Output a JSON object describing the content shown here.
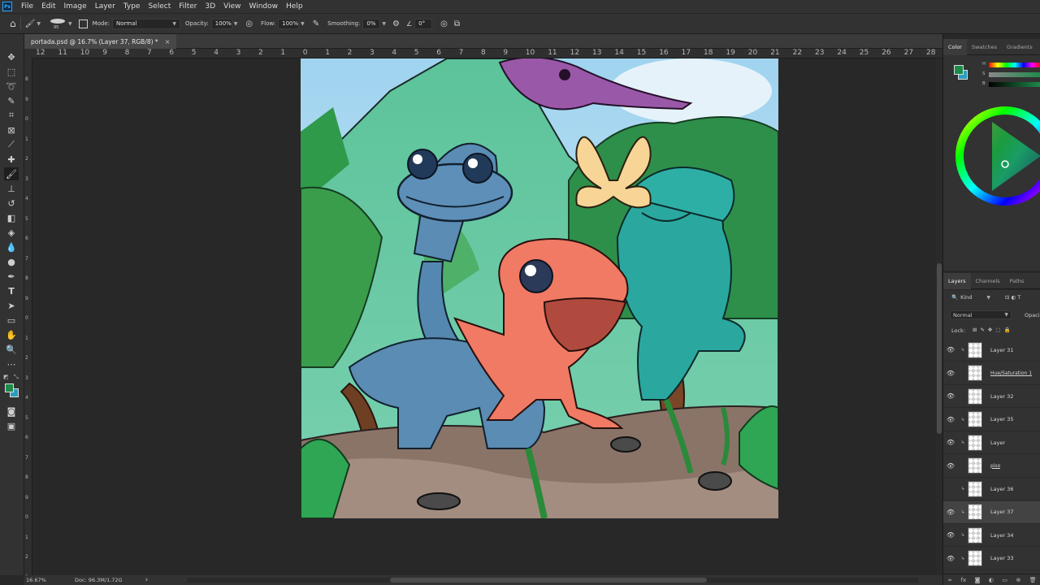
{
  "menu": {
    "logo": "Ps",
    "items": [
      "File",
      "Edit",
      "Image",
      "Layer",
      "Type",
      "Select",
      "Filter",
      "3D",
      "View",
      "Window",
      "Help"
    ]
  },
  "options": {
    "brush_size": "95",
    "mode_label": "Mode:",
    "mode_value": "Normal",
    "opacity_label": "Opacity:",
    "opacity_value": "100%",
    "flow_label": "Flow:",
    "flow_value": "100%",
    "smoothing_label": "Smoothing:",
    "smoothing_value": "0%",
    "angle_value": "0°"
  },
  "document": {
    "tab_title": "portada.psd @ 16.7% (Layer 37, RGB/8) *",
    "close": "×"
  },
  "ruler_top_labels": [
    "12",
    "11",
    "10",
    "9",
    "8",
    "7",
    "6",
    "5",
    "4",
    "3",
    "2",
    "1",
    "0",
    "1",
    "2",
    "3",
    "4",
    "5",
    "6",
    "7",
    "8",
    "9",
    "10",
    "11",
    "12",
    "13",
    "14",
    "15",
    "16",
    "17",
    "18",
    "19",
    "20",
    "21",
    "22",
    "23",
    "24",
    "25",
    "26",
    "27",
    "28"
  ],
  "ruler_left_labels": [
    "8",
    "9",
    "0",
    "1",
    "2",
    "3",
    "4",
    "5",
    "6",
    "7",
    "8",
    "9",
    "0",
    "1",
    "2",
    "3",
    "4",
    "5",
    "6",
    "7",
    "8",
    "9",
    "0",
    "1",
    "2",
    "3"
  ],
  "status": {
    "zoom": "16.67%",
    "doc": "Doc: 96.3M/1.72G",
    "arrow": "›"
  },
  "color_panel": {
    "tabs": [
      "Color",
      "Swatches",
      "Gradients",
      "P"
    ],
    "slider_labels": [
      "H",
      "S",
      "B"
    ],
    "foreground": "#1e8a4a",
    "background": "#2a9dc0"
  },
  "layers_panel": {
    "tabs": [
      "Layers",
      "Channels",
      "Paths"
    ],
    "filter_kind": "Kind",
    "blend_mode": "Normal",
    "opacity_label": "Opaci",
    "lock_label": "Lock:",
    "layers": [
      {
        "name": "Layer 31",
        "visible": true,
        "clipped": true,
        "selected": false
      },
      {
        "name": "Hue/Saturation 1",
        "visible": true,
        "clipped": false,
        "selected": false
      },
      {
        "name": "Layer 32",
        "visible": true,
        "clipped": false,
        "selected": false
      },
      {
        "name": "Layer 35",
        "visible": true,
        "clipped": true,
        "selected": false
      },
      {
        "name": "Layer",
        "visible": true,
        "clipped": true,
        "selected": false
      },
      {
        "name": "piso",
        "visible": true,
        "clipped": false,
        "selected": false
      },
      {
        "name": "Layer 36",
        "visible": false,
        "clipped": true,
        "selected": false
      },
      {
        "name": "Layer 37",
        "visible": true,
        "clipped": true,
        "selected": true
      },
      {
        "name": "Layer 34",
        "visible": true,
        "clipped": true,
        "selected": false
      },
      {
        "name": "Layer 33",
        "visible": true,
        "clipped": true,
        "selected": false
      }
    ]
  }
}
